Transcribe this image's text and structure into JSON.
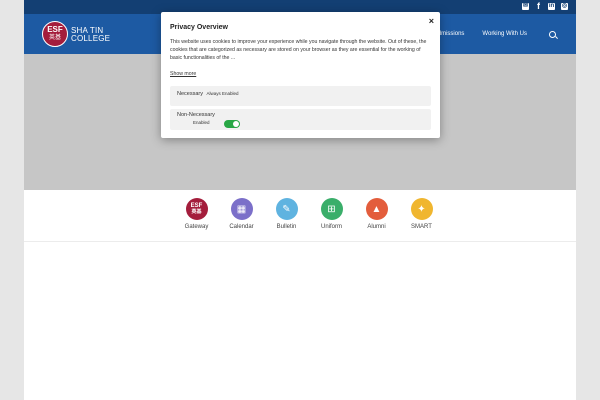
{
  "header": {
    "logo_top": "ESF",
    "logo_chinese": "英基",
    "school_line1": "SHA TIN",
    "school_line2": "COLLEGE",
    "nav": [
      "Admissions",
      "Working With Us"
    ]
  },
  "social": [
    "email-icon",
    "facebook-icon",
    "linkedin-icon",
    "instagram-icon"
  ],
  "quick_links": [
    {
      "label": "Gateway",
      "color": "#a41d3c",
      "icon": "esf-logo-icon"
    },
    {
      "label": "Calendar",
      "color": "#7b6fc9",
      "icon": "calendar-icon"
    },
    {
      "label": "Bulletin",
      "color": "#5fb3e0",
      "icon": "pin-icon"
    },
    {
      "label": "Uniform",
      "color": "#3aae6a",
      "icon": "shirt-icon"
    },
    {
      "label": "Alumni",
      "color": "#e35d3c",
      "icon": "graduation-cap-icon"
    },
    {
      "label": "SMART",
      "color": "#f0b62f",
      "icon": "lightbulb-icon"
    }
  ],
  "privacy_modal": {
    "title": "Privacy Overview",
    "body": "This website uses cookies to improve your experience while you navigate through the website. Out of these, the cookies that are categorized as necessary are stored on your browser as they are essential for the working of basic functionalities of the ...",
    "show_more": "Show more",
    "necessary_label": "Necessary",
    "necessary_status": "Always Enabled",
    "non_necessary_label": "Non-Necessary",
    "non_necessary_status": "Enabled",
    "close": "×"
  }
}
